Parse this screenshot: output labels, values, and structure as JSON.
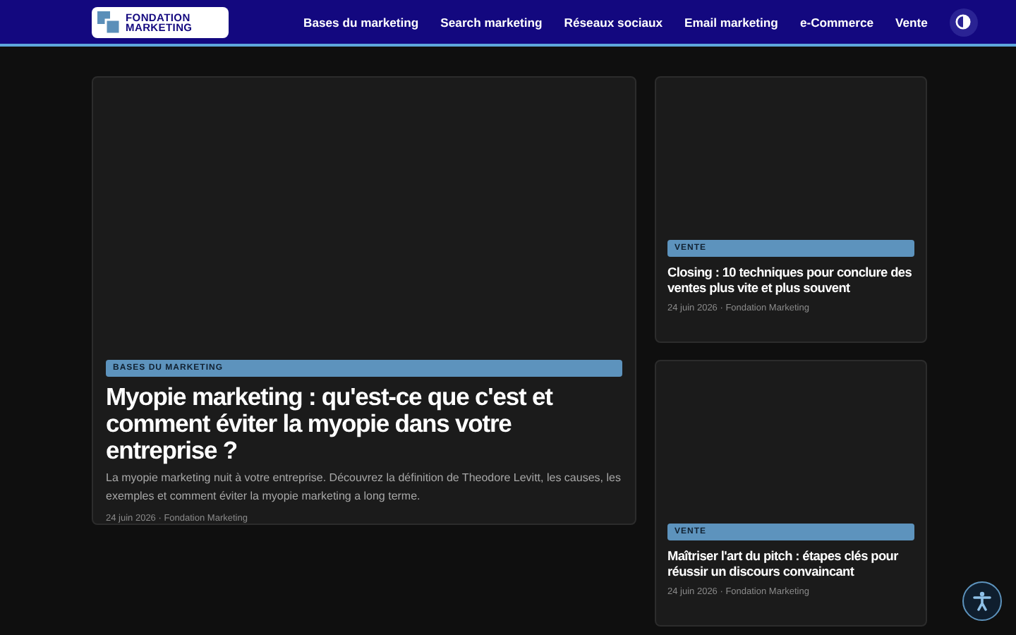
{
  "header": {
    "logo": [
      "FONDATION",
      "MARKETING"
    ],
    "nav": [
      "Bases du marketing",
      "Search marketing",
      "Réseaux sociaux",
      "Email marketing",
      "e-Commerce",
      "Vente"
    ]
  },
  "featured": {
    "category": "BASES DU MARKETING",
    "title": "Myopie marketing : qu'est-ce que c'est et comment éviter la myopie dans votre entreprise ?",
    "excerpt": "La myopie marketing nuit à votre entreprise. Découvrez la définition de Theodore Levitt, les causes, les exemples et comment éviter la myopie marketing a long terme.",
    "meta": "24 juin 2026 · Fondation Marketing"
  },
  "side_articles": [
    {
      "category": "VENTE",
      "title": "Closing : 10 techniques pour conclure des ventes plus vite et plus souvent",
      "meta": "24 juin 2026 · Fondation Marketing"
    },
    {
      "category": "VENTE",
      "title": "Maîtriser l'art du pitch : étapes clés pour réussir un discours convaincant",
      "meta": "24 juin 2026 · Fondation Marketing"
    }
  ]
}
